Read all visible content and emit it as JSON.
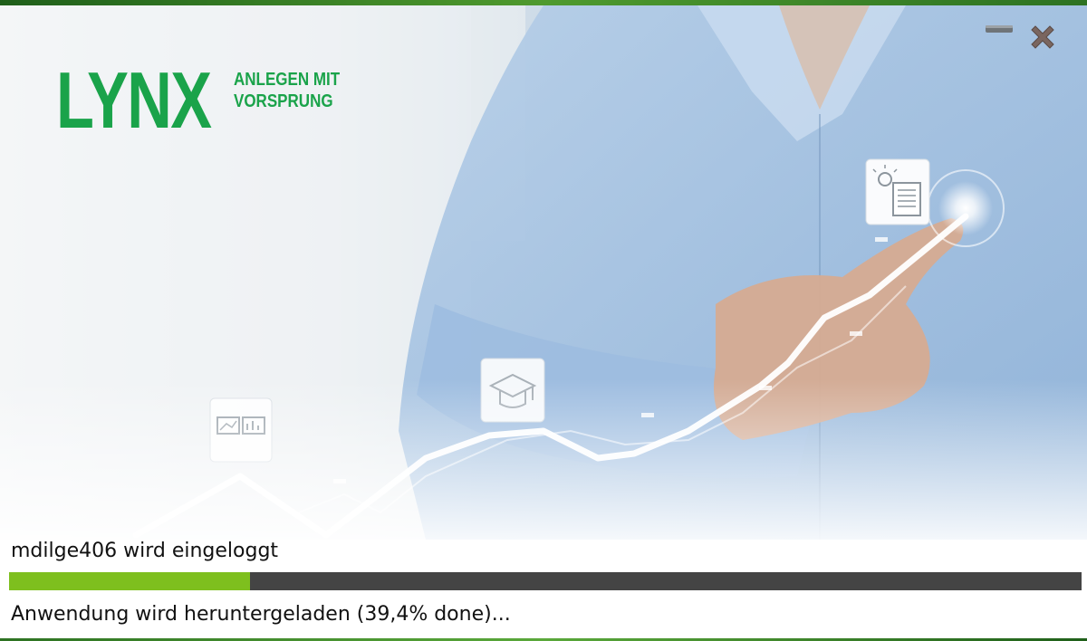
{
  "window": {
    "minimize_icon": "minimize-icon",
    "close_icon": "close-x-icon"
  },
  "brand": {
    "name": "LYNX",
    "tagline_line1": "ANLEGEN MIT",
    "tagline_line2": "VORSPRUNG",
    "color": "#1aa34a"
  },
  "hero": {
    "icons": [
      "trading-screens-icon",
      "graduation-cap-icon",
      "idea-document-icon"
    ]
  },
  "status": {
    "login_text": "mdilge406 wird eingeloggt",
    "progress_fraction": 0.225,
    "progress_color": "#7ebf1e",
    "progress_track_color": "#444444",
    "download_text": "Anwendung wird heruntergeladen (39,4% done)..."
  }
}
